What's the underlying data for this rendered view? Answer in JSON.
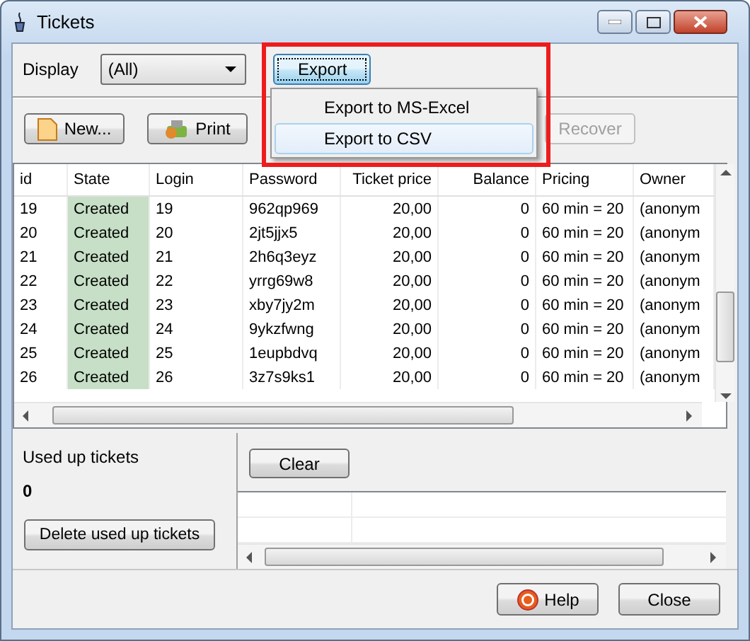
{
  "window": {
    "title": "Tickets"
  },
  "display": {
    "label": "Display",
    "value": "(All)"
  },
  "export_button": {
    "label": "Export"
  },
  "export_menu": [
    {
      "label": "Export to MS-Excel",
      "selected": false
    },
    {
      "label": "Export to CSV",
      "selected": true
    }
  ],
  "toolbar": [
    {
      "label": "New...",
      "kind": "new",
      "disabled": false
    },
    {
      "label": "Print",
      "kind": "print",
      "disabled": false
    },
    {
      "label": "Recover",
      "kind": "plain",
      "disabled": true
    }
  ],
  "table": {
    "columns": [
      "id",
      "State",
      "Login",
      "Password",
      "Ticket price",
      "Balance",
      "Pricing",
      "Owner"
    ],
    "rows": [
      [
        "19",
        "Created",
        "19",
        "962qp969",
        "20,00",
        "0",
        "60 min = 20",
        "(anonym"
      ],
      [
        "20",
        "Created",
        "20",
        "2jt5jjx5",
        "20,00",
        "0",
        "60 min = 20",
        "(anonym"
      ],
      [
        "21",
        "Created",
        "21",
        "2h6q3eyz",
        "20,00",
        "0",
        "60 min = 20",
        "(anonym"
      ],
      [
        "22",
        "Created",
        "22",
        "yrrg69w8",
        "20,00",
        "0",
        "60 min = 20",
        "(anonym"
      ],
      [
        "23",
        "Created",
        "23",
        "xby7jy2m",
        "20,00",
        "0",
        "60 min = 20",
        "(anonym"
      ],
      [
        "24",
        "Created",
        "24",
        "9ykzfwng",
        "20,00",
        "0",
        "60 min = 20",
        "(anonym"
      ],
      [
        "25",
        "Created",
        "25",
        "1eupbdvq",
        "20,00",
        "0",
        "60 min = 20",
        "(anonym"
      ],
      [
        "26",
        "Created",
        "26",
        "3z7s9ks1",
        "20,00",
        "0",
        "60 min = 20",
        "(anonym"
      ]
    ]
  },
  "used_up": {
    "label": "Used up tickets",
    "count": "0",
    "button": "Delete used up tickets"
  },
  "clear_button": {
    "label": "Clear"
  },
  "buttons": [
    {
      "label": "Help",
      "kind": "help"
    },
    {
      "label": "Close",
      "kind": "plain"
    }
  ]
}
